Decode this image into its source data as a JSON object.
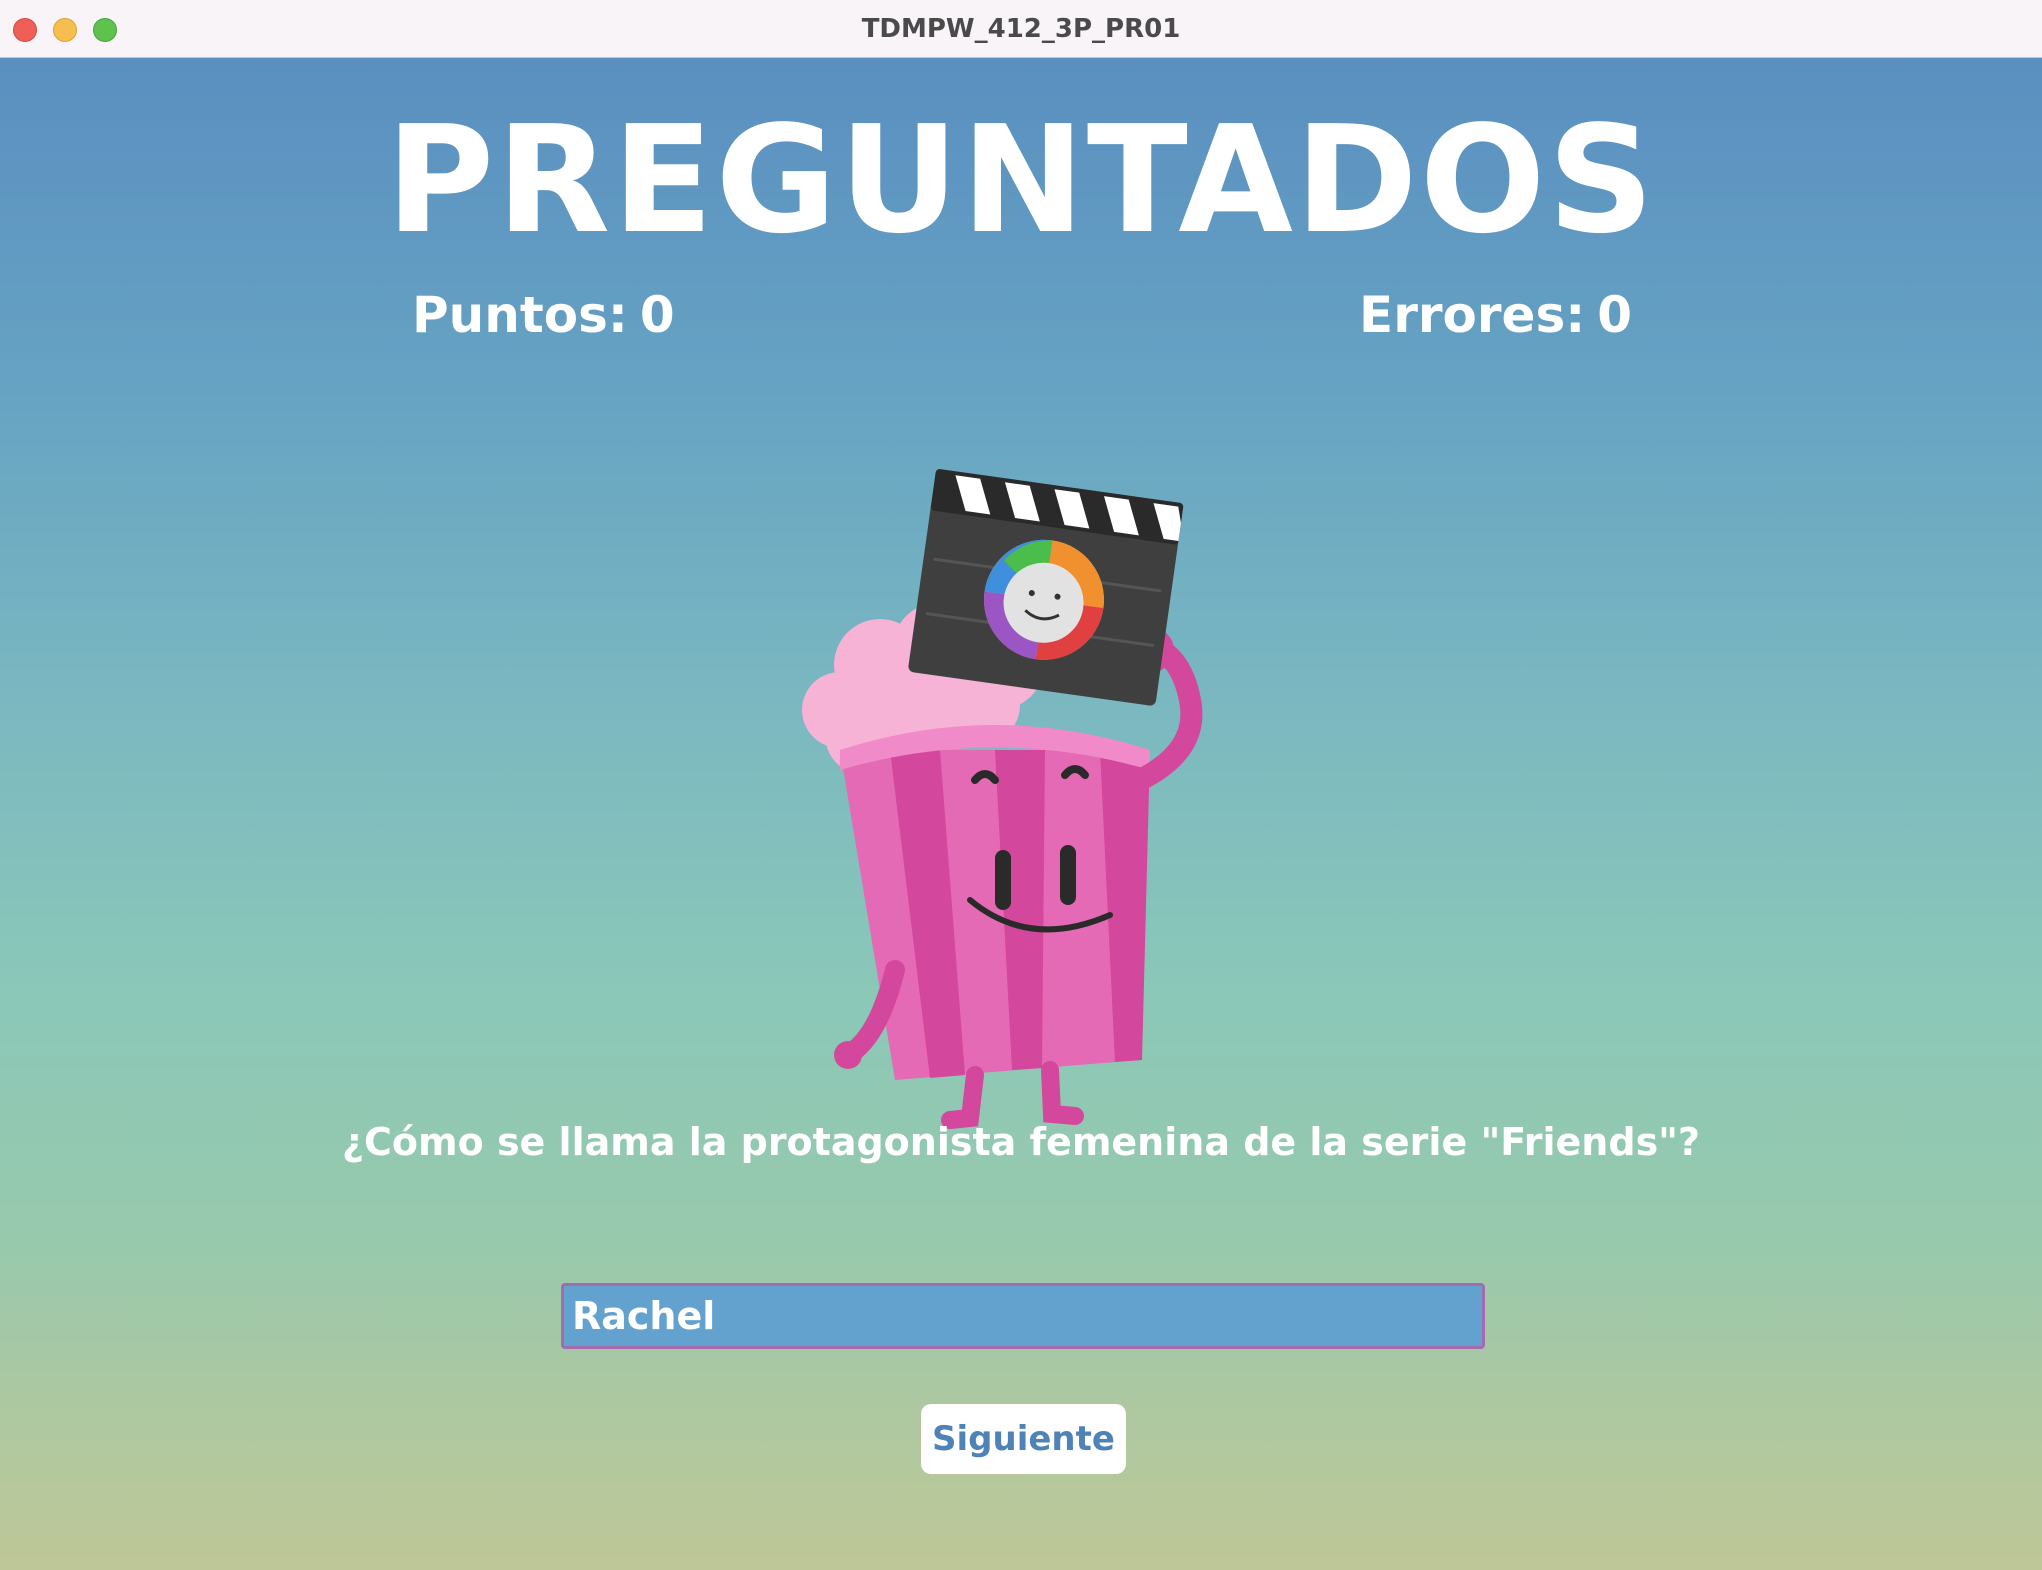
{
  "window": {
    "title": "TDMPW_412_3P_PR01"
  },
  "game": {
    "title": "PREGUNTADOS",
    "points_label": "Puntos:",
    "points_value": "0",
    "errors_label": "Errores:",
    "errors_value": "0",
    "question": "¿Cómo se llama la protagonista femenina de la serie \"Friends\"?",
    "answer_value": "Rachel",
    "next_label": "Siguiente"
  },
  "colors": {
    "input_background": "#63a2cf",
    "input_border": "#a46bb0",
    "button_text": "#4f83b8",
    "mascot_pink": "#e066b0"
  },
  "icons": {
    "mascot": "popcorn-character-icon",
    "clapperboard": "clapperboard-icon"
  }
}
